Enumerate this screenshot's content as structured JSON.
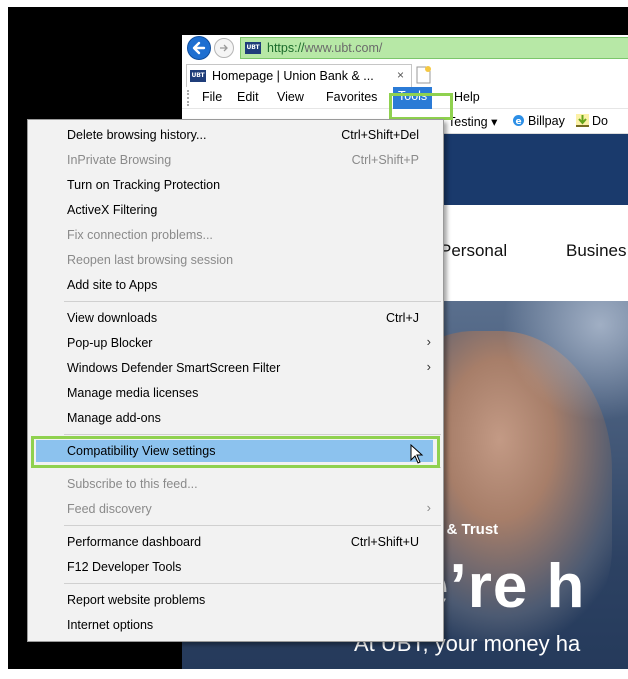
{
  "address_bar": {
    "site_badge": "UBT",
    "url_secure": "https://",
    "url_rest": "www.ubt.com/"
  },
  "tab": {
    "title": "Homepage | Union Bank & ...",
    "close": "×"
  },
  "menu_bar": {
    "items": [
      "File",
      "Edit",
      "View",
      "Favorites",
      "Tools",
      "Help"
    ]
  },
  "favorites_bar": {
    "items": [
      "Testing ▾",
      "Billpay",
      "Do"
    ]
  },
  "site": {
    "nav": [
      "Personal",
      "Busines"
    ],
    "hero_tag": "k & Trust",
    "hero_headline": "e’re h",
    "hero_sub": "At UBT, your money ha"
  },
  "tools_menu": {
    "groups": [
      [
        {
          "label": "Delete browsing history...",
          "shortcut": "Ctrl+Shift+Del",
          "disabled": false
        },
        {
          "label": "InPrivate Browsing",
          "shortcut": "Ctrl+Shift+P",
          "disabled": true
        },
        {
          "label": "Turn on Tracking Protection",
          "shortcut": "",
          "disabled": false
        },
        {
          "label": "ActiveX Filtering",
          "shortcut": "",
          "disabled": false
        },
        {
          "label": "Fix connection problems...",
          "shortcut": "",
          "disabled": true
        },
        {
          "label": "Reopen last browsing session",
          "shortcut": "",
          "disabled": true
        },
        {
          "label": "Add site to Apps",
          "shortcut": "",
          "disabled": false
        }
      ],
      [
        {
          "label": "View downloads",
          "shortcut": "Ctrl+J",
          "disabled": false
        },
        {
          "label": "Pop-up Blocker",
          "shortcut": "",
          "submenu": true,
          "disabled": false
        },
        {
          "label": "Windows Defender SmartScreen Filter",
          "shortcut": "",
          "submenu": true,
          "disabled": false
        },
        {
          "label": "Manage media licenses",
          "shortcut": "",
          "disabled": false
        },
        {
          "label": "Manage add-ons",
          "shortcut": "",
          "disabled": false
        }
      ],
      [
        {
          "label": "Compatibility View settings",
          "shortcut": "",
          "disabled": false,
          "selected": true
        }
      ],
      [
        {
          "label": "Subscribe to this feed...",
          "shortcut": "",
          "disabled": true
        },
        {
          "label": "Feed discovery",
          "shortcut": "",
          "submenu": true,
          "disabled": true
        }
      ],
      [
        {
          "label": "Performance dashboard",
          "shortcut": "Ctrl+Shift+U",
          "disabled": false
        },
        {
          "label": "F12 Developer Tools",
          "shortcut": "",
          "disabled": false
        }
      ],
      [
        {
          "label": "Report website problems",
          "shortcut": "",
          "disabled": false
        },
        {
          "label": "Internet options",
          "shortcut": "",
          "disabled": false
        }
      ]
    ],
    "submenu_arrow": "›"
  },
  "colors": {
    "menu_bg": "#f2f2f2",
    "selected_bg": "#8cc2ee",
    "highlight_outline": "#8fd14f",
    "url_bg": "#b7e8a6",
    "navy": "#1a3a6c"
  }
}
